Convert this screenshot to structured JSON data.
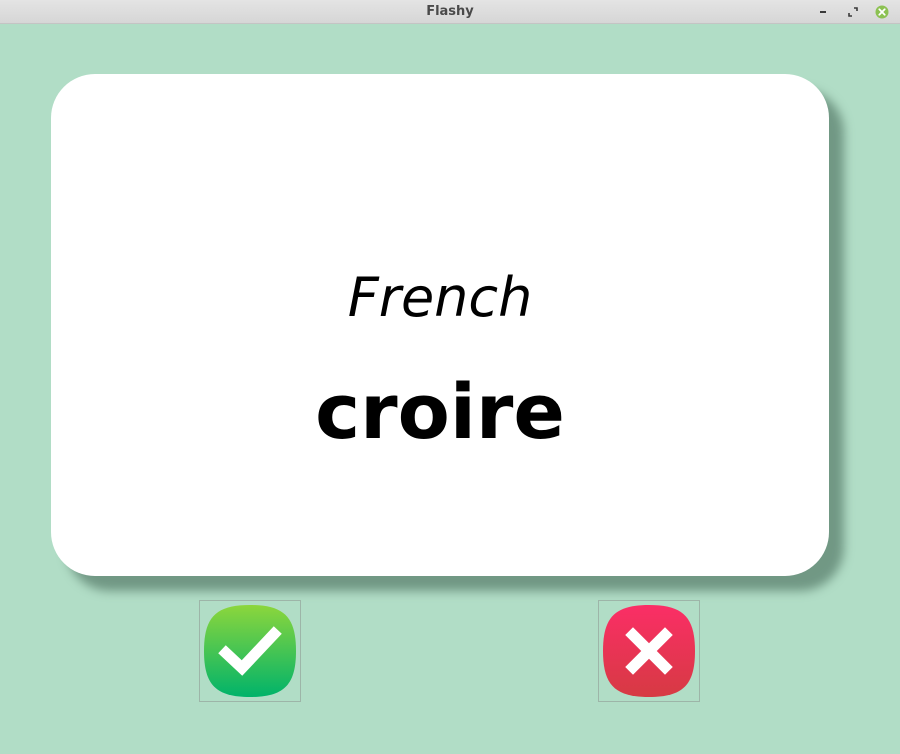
{
  "window": {
    "title": "Flashy",
    "background": "#b1ddc6"
  },
  "card": {
    "title": "French",
    "word": "croire",
    "background": "#ffffff"
  },
  "buttons": {
    "known": {
      "icon": "check-icon",
      "color": "#2ecc71"
    },
    "unknown": {
      "icon": "cross-icon",
      "color": "#e63a5a"
    }
  }
}
